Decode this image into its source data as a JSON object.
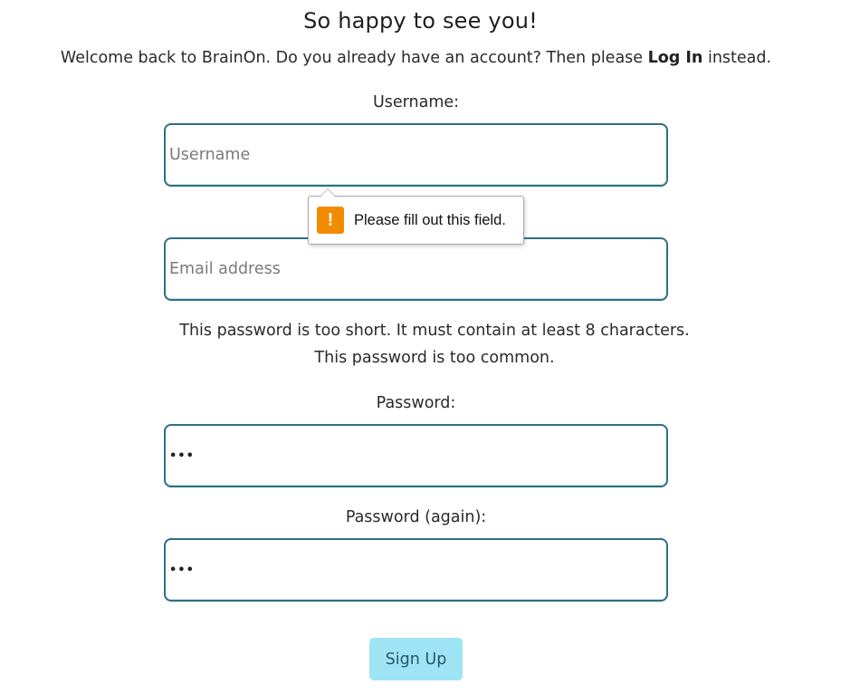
{
  "page": {
    "heading": "So happy to see you!",
    "welcome_prefix": "Welcome back to BrainOn. Do you already have an account? Then please ",
    "login_link": "Log In",
    "welcome_suffix": " instead."
  },
  "form": {
    "username": {
      "label": "Username:",
      "placeholder": "Username",
      "value": ""
    },
    "email": {
      "placeholder": "Email address",
      "value": ""
    },
    "errors": [
      "This password is too short. It must contain at least 8 characters.",
      "This password is too common."
    ],
    "password": {
      "label": "Password:",
      "value": "abc"
    },
    "password_again": {
      "label": "Password (again):",
      "value": "abc"
    },
    "submit_label": "Sign Up"
  },
  "validation_tooltip": {
    "message": "Please fill out this field.",
    "icon": "warning-icon",
    "icon_glyph": "!"
  },
  "colors": {
    "field_border": "#2f6f84",
    "button_bg": "#9fe4f4",
    "warning": "#f28b00"
  }
}
